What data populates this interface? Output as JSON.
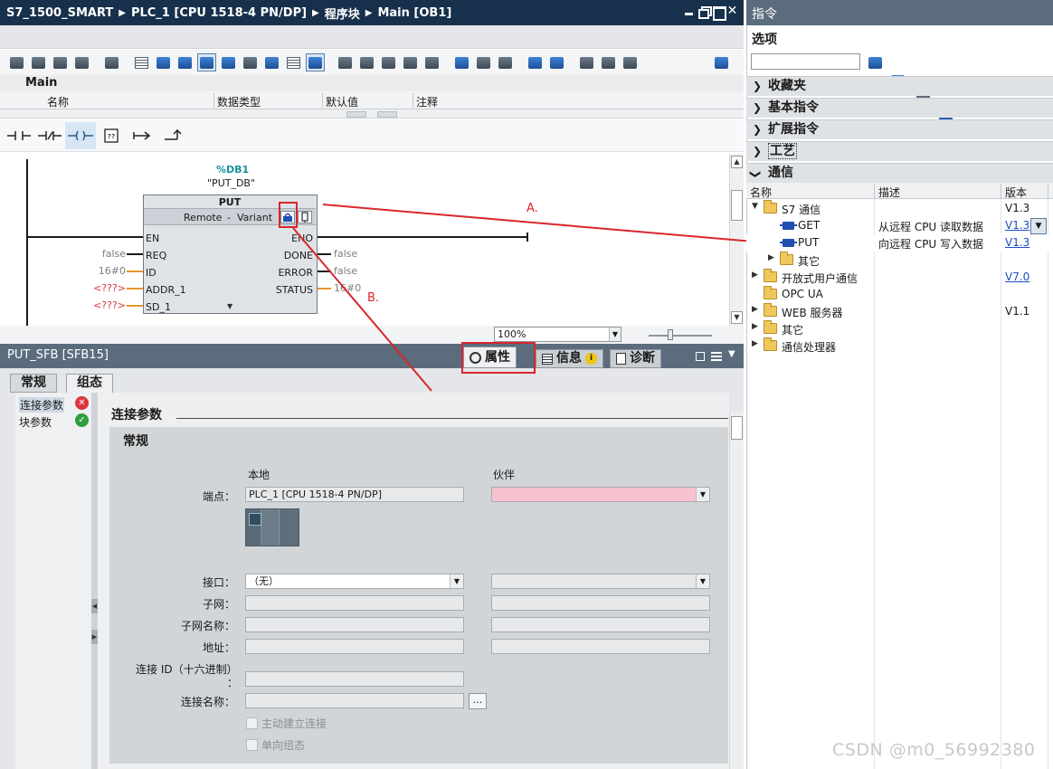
{
  "editor": {
    "breadcrumb": [
      "S7_1500_SMART",
      "PLC_1 [CPU 1518-4 PN/DP]",
      "程序块",
      "Main [OB1]"
    ],
    "close_glyph": "✕",
    "section_label": "Main",
    "columns": [
      "名称",
      "数据类型",
      "默认值",
      "注释"
    ],
    "zoom": "100%"
  },
  "ladder": {
    "db_address": "%DB1",
    "db_name": "\"PUT_DB\"",
    "block_type": "PUT",
    "block_sub_left": "Remote",
    "block_sub_dash": "-",
    "block_sub_right": "Variant",
    "inputs": [
      {
        "pin": "EN",
        "value": ""
      },
      {
        "pin": "REQ",
        "value": "false"
      },
      {
        "pin": "ID",
        "value": "16#0"
      },
      {
        "pin": "ADDR_1",
        "value": "<???>"
      },
      {
        "pin": "SD_1",
        "value": "<???>"
      }
    ],
    "outputs": [
      {
        "pin": "ENO",
        "value": ""
      },
      {
        "pin": "DONE",
        "value": "false"
      },
      {
        "pin": "ERROR",
        "value": "false"
      },
      {
        "pin": "STATUS",
        "value": "16#0"
      }
    ],
    "annotation_a": "A.",
    "annotation_b": "B."
  },
  "properties": {
    "title": "PUT_SFB [SFB15]",
    "tabs": [
      "属性",
      "信息",
      "诊断"
    ],
    "info_glyph": "i",
    "subtabs": [
      "常规",
      "组态"
    ],
    "nav": [
      {
        "label": "连接参数",
        "status": "error",
        "glyph": "✕",
        "color": "#d9363e"
      },
      {
        "label": "块参数",
        "status": "ok",
        "glyph": "✓",
        "color": "#2e9e3e"
      }
    ],
    "section_title": "连接参数",
    "group_title": "常规",
    "col_local": "本地",
    "col_partner": "伙伴",
    "labels": {
      "endpoint": "端点：",
      "interface": "接口：",
      "subnet": "子网：",
      "subnet_name": "子网名称：",
      "address": "地址：",
      "conn_id": "连接 ID（十六进制）",
      "conn_id_colon": "：",
      "conn_name": "连接名称："
    },
    "endpoint_local": "PLC_1 [CPU 1518-4 PN/DP]",
    "interface_local": "（无）",
    "browse": "...",
    "checkboxes": [
      "主动建立连接",
      "单向组态"
    ]
  },
  "instructions": {
    "title": "指令",
    "options": "选项",
    "sections": [
      {
        "label": "收藏夹",
        "expanded": false
      },
      {
        "label": "基本指令",
        "expanded": false
      },
      {
        "label": "扩展指令",
        "expanded": false
      },
      {
        "label": "工艺",
        "expanded": false
      },
      {
        "label": "通信",
        "expanded": true
      }
    ],
    "columns": [
      "名称",
      "描述",
      "版本"
    ],
    "rows": [
      {
        "name": "S7 通信",
        "desc": "",
        "version": "V1.3",
        "kind": "folder",
        "toggle": "▼",
        "level": 0,
        "link": false
      },
      {
        "name": "GET",
        "desc": "从远程 CPU 读取数据",
        "version": "V1.3",
        "kind": "fb",
        "toggle": "",
        "level": 1,
        "link": true
      },
      {
        "name": "PUT",
        "desc": "向远程 CPU 写入数据",
        "version": "V1.3",
        "kind": "fb",
        "toggle": "",
        "level": 1,
        "link": true
      },
      {
        "name": "其它",
        "desc": "",
        "version": "",
        "kind": "folder",
        "toggle": "▶",
        "level": 1,
        "link": false
      },
      {
        "name": "开放式用户通信",
        "desc": "",
        "version": "V7.0",
        "kind": "folder",
        "toggle": "▶",
        "level": 0,
        "link": true
      },
      {
        "name": "OPC UA",
        "desc": "",
        "version": "",
        "kind": "folder",
        "toggle": "",
        "level": 0,
        "link": false
      },
      {
        "name": "WEB 服务器",
        "desc": "",
        "version": "V1.1",
        "kind": "folder",
        "toggle": "▶",
        "level": 0,
        "link": false
      },
      {
        "name": "其它",
        "desc": "",
        "version": "",
        "kind": "folder",
        "toggle": "▶",
        "level": 0,
        "link": false
      },
      {
        "name": "通信处理器",
        "desc": "",
        "version": "",
        "kind": "folder",
        "toggle": "▶",
        "level": 0,
        "link": false
      }
    ]
  },
  "watermark": "CSDN @m0_56992380"
}
